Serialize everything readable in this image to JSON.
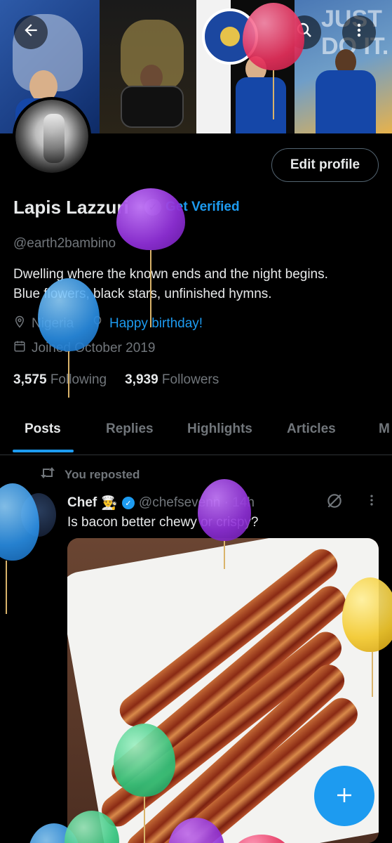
{
  "header": {
    "back_icon": "arrow-left-icon",
    "search_icon": "search-icon",
    "more_icon": "more-vertical-icon",
    "banner_text": "JUST DO IT."
  },
  "profile": {
    "edit_button": "Edit profile",
    "name": "Lapis Lazzuri",
    "get_verified": "Get Verified",
    "handle": "@earth2bambino",
    "bio_line1": "Dwelling where the known ends and the night begins.",
    "bio_line2": "Blue flowers, black stars, unfinished hymns.",
    "location": "Nigeria",
    "birthday": "Happy birthday!",
    "joined": "Joined October 2019",
    "following_count": "3,575",
    "following_label": "Following",
    "followers_count": "3,939",
    "followers_label": "Followers"
  },
  "tabs": [
    "Posts",
    "Replies",
    "Highlights",
    "Articles",
    "M"
  ],
  "post": {
    "repost_label": "You reposted",
    "author_name": "Chef",
    "author_emoji": "👨‍🍳",
    "author_handle": "@chefsevenn · 14h",
    "text": "Is bacon better chewy or crispy?"
  },
  "colors": {
    "accent": "#1d9bf0",
    "background": "#000000",
    "muted": "#71767b"
  }
}
